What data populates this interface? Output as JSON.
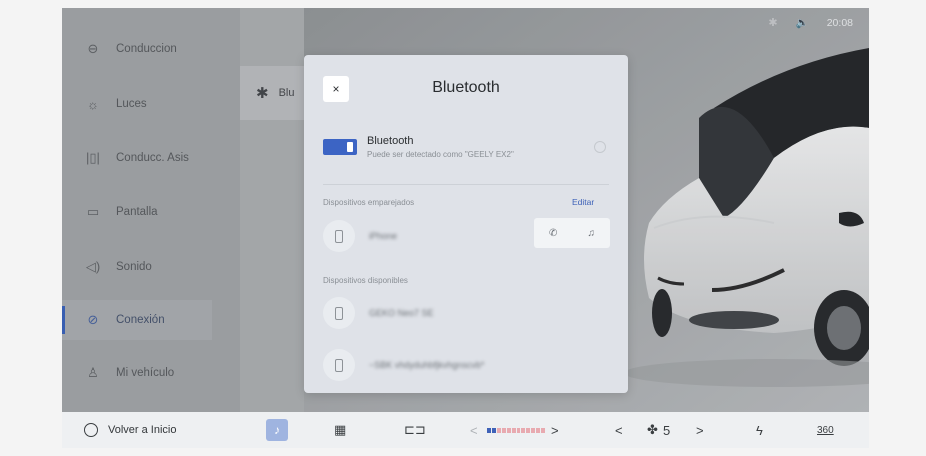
{
  "status_bar": {
    "bluetooth_icon": "bluetooth-icon",
    "volume_icon": "speaker-icon",
    "time": "20:08"
  },
  "sidebar": {
    "items": [
      {
        "label": "Conduccion",
        "icon": "steering-wheel-icon"
      },
      {
        "label": "Luces",
        "icon": "light-icon"
      },
      {
        "label": "Conducc. Asis",
        "icon": "assist-icon"
      },
      {
        "label": "Pantalla",
        "icon": "display-icon"
      },
      {
        "label": "Sonido",
        "icon": "speaker-icon"
      },
      {
        "label": "Conexión",
        "icon": "link-icon"
      },
      {
        "label": "Mi vehículo",
        "icon": "person-icon"
      }
    ],
    "active_index": 5,
    "accent_color": "#2f5bb8"
  },
  "middle_panel": {
    "label": "Blu"
  },
  "modal": {
    "title": "Bluetooth",
    "close_glyph": "×",
    "toggle": {
      "label": "Bluetooth",
      "sub": "Puede ser detectado como \"GEELY EX2\"",
      "on": true
    },
    "paired_label": "Dispositivos emparejados",
    "edit_label": "Editar",
    "paired_devices": [
      {
        "name": "iPhone"
      }
    ],
    "available_label": "Dispositivos disponibles",
    "available_devices": [
      {
        "name": "GEKO Neo7 SE"
      },
      {
        "name": "~SBK vhdyduhbfjkvhgnscvb*"
      }
    ]
  },
  "bottom_bar": {
    "home_label": "Volver a Inicio",
    "fan_speed": "5",
    "temp_left": "<",
    "temp_right": ">",
    "fan_left": "<",
    "fan_right": ">",
    "view_label": "360"
  }
}
